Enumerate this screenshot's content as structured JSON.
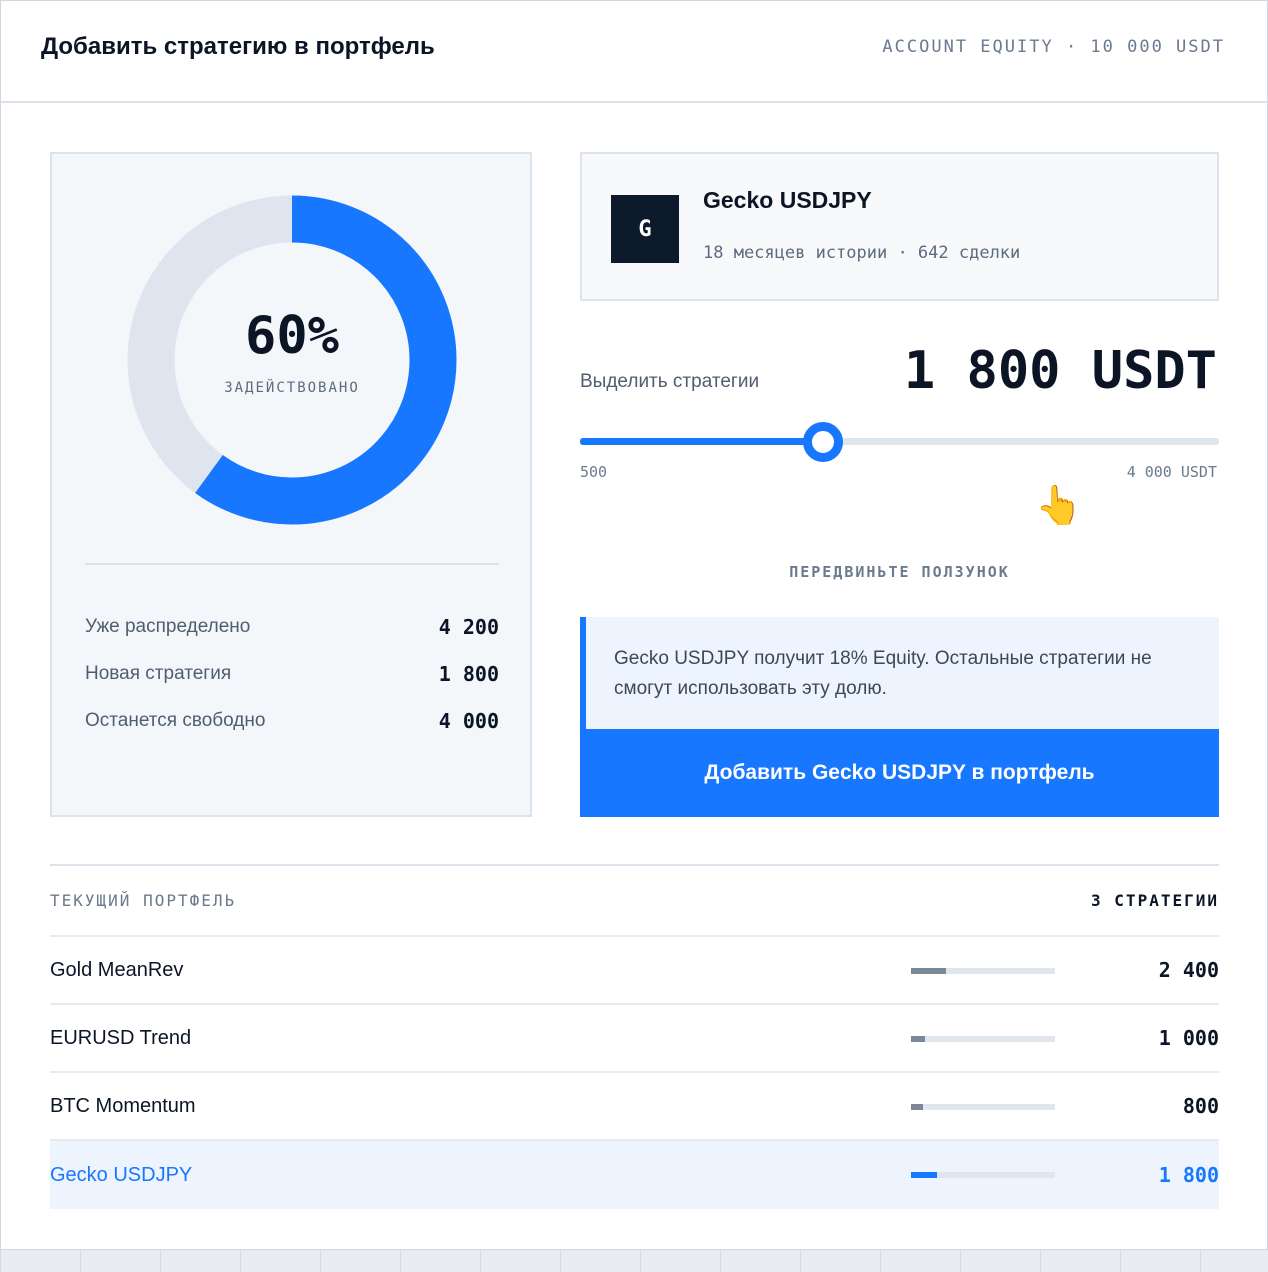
{
  "header": {
    "title": "Добавить стратегию в портфель",
    "equity": "ACCOUNT EQUITY · 10 000 USDT"
  },
  "usage": {
    "percent_value": 0.6,
    "percent_text": "60%",
    "label": "ЗАДЕЙСТВОВАНО",
    "colors": {
      "used": "#1877ff",
      "free": "#dfe5ee"
    },
    "stats": [
      {
        "label": "Уже распределено",
        "value": "4 200"
      },
      {
        "label": "Новая стратегия",
        "value": "1 800"
      },
      {
        "label": "Останется свободно",
        "value": "4 000"
      }
    ]
  },
  "strategy": {
    "logo_letter": "G",
    "name": "Gecko USDJPY",
    "meta": "18 месяцев истории · 642 сделки"
  },
  "allocation": {
    "label": "Выделить стратегии",
    "value_text": "1 800 USDT",
    "slider": {
      "min": 500,
      "max": 4000,
      "value": 1800,
      "min_label": "500",
      "max_label": "4 000 USDT"
    },
    "hand_icon": "pointing-hand-icon",
    "hint": "ПЕРЕДВИНЬТЕ ПОЛЗУНОК"
  },
  "note": {
    "text": "Gecko USDJPY получит 18% Equity. Остальные стратегии не смогут использовать эту долю."
  },
  "add_button": {
    "label": "Добавить Gecko USDJPY в портфель"
  },
  "portfolio": {
    "title": "ТЕКУЩИЙ ПОРТФЕЛЬ",
    "count": "3 СТРАТЕГИИ",
    "rows": [
      {
        "name": "Gold MeanRev",
        "value": "2 400",
        "share": 0.24
      },
      {
        "name": "EURUSD Trend",
        "value": "1 000",
        "share": 0.1
      },
      {
        "name": "BTC Momentum",
        "value": "800",
        "share": 0.08
      },
      {
        "name": "Gecko USDJPY",
        "value": "1 800",
        "share": 0.18
      }
    ]
  },
  "colors": {
    "accent": "#1877ff",
    "dark": "#0b1526"
  }
}
